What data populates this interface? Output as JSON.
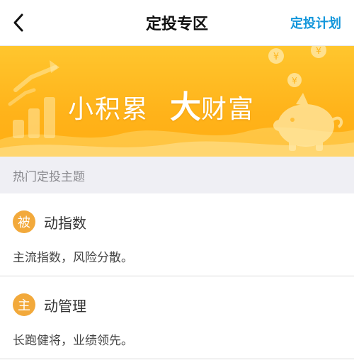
{
  "nav": {
    "title": "定投专区",
    "right_label": "定投计划",
    "back_icon": "chevron-left-icon"
  },
  "banner": {
    "slogan_part1": "小积累",
    "slogan_part2": "大",
    "slogan_part3": "财富",
    "colors": {
      "top": "#ffc62e",
      "bottom": "#ffad12",
      "decoration": "#ffe07a"
    }
  },
  "section": {
    "header": "热门定投主题"
  },
  "topics": [
    {
      "badge": "被",
      "title": "动指数",
      "desc": "主流指数，风险分散。"
    },
    {
      "badge": "主",
      "title": "动管理",
      "desc": "长跑健将，业绩领先。"
    }
  ],
  "colors": {
    "accent": "#1296db",
    "badge": "#f2a93b"
  }
}
